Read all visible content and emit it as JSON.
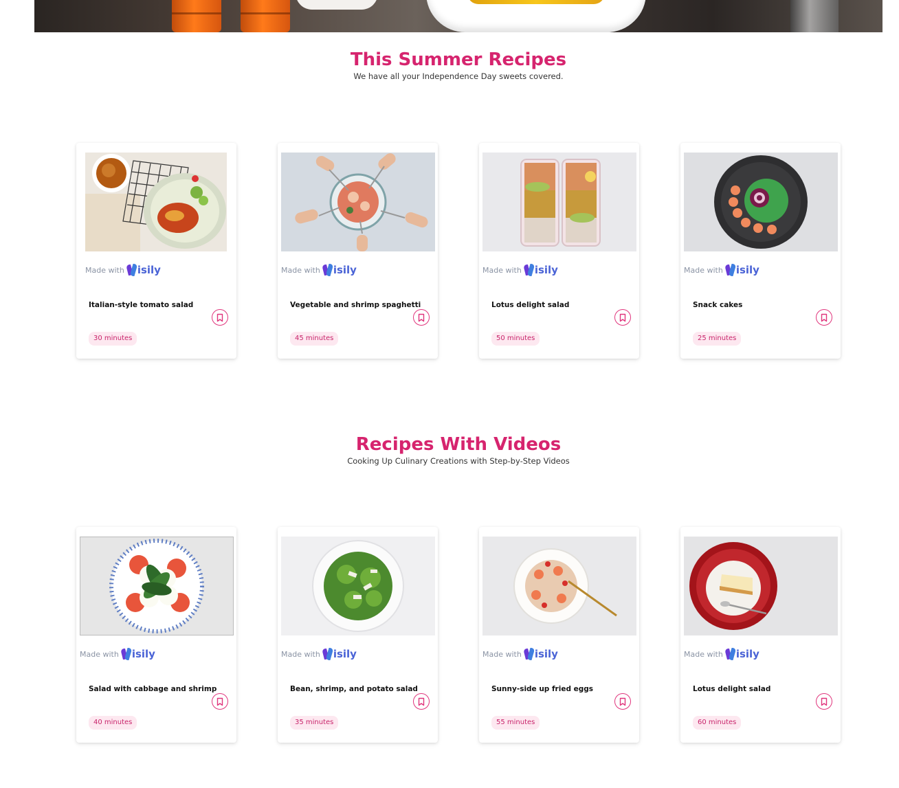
{
  "sections": [
    {
      "title": "This Summer Recipes",
      "subtitle": "We have all your Independence Day sweets covered.",
      "cards": [
        {
          "name": "Italian-style tomato salad",
          "time": "30 minutes",
          "made_with": "Made with",
          "brand": "isily",
          "image": "food-photo-tomato-dish"
        },
        {
          "name": "Vegetable and shrimp spaghetti",
          "time": "45 minutes",
          "made_with": "Made with",
          "brand": "isily",
          "image": "food-photo-shared-pasta"
        },
        {
          "name": "Lotus delight salad",
          "time": "50 minutes",
          "made_with": "Made with",
          "brand": "isily",
          "image": "food-photo-lunch-boxes"
        },
        {
          "name": "Snack cakes",
          "time": "25 minutes",
          "made_with": "Made with",
          "brand": "isily",
          "image": "food-photo-shrimp-bowl"
        }
      ]
    },
    {
      "title": "Recipes With Videos",
      "subtitle": "Cooking Up Culinary Creations with Step-by-Step Videos",
      "cards": [
        {
          "name": "Salad with cabbage and shrimp",
          "time": "40 minutes",
          "made_with": "Made with",
          "brand": "isily",
          "image": "food-photo-caprese"
        },
        {
          "name": "Bean, shrimp, and potato salad",
          "time": "35 minutes",
          "made_with": "Made with",
          "brand": "isily",
          "image": "food-photo-green-salad"
        },
        {
          "name": "Sunny-side up fried eggs",
          "time": "55 minutes",
          "made_with": "Made with",
          "brand": "isily",
          "image": "food-photo-shrimp-spaghetti"
        },
        {
          "name": "Lotus delight salad",
          "time": "60 minutes",
          "made_with": "Made with",
          "brand": "isily",
          "image": "food-photo-cheesecake"
        }
      ]
    }
  ],
  "colors": {
    "accent": "#d6246e",
    "badge_bg": "#fde8f0",
    "brand_blue": "#4a63d6"
  },
  "icons": {
    "bookmark": "bookmark-icon",
    "logo": "visily-logo-icon"
  }
}
